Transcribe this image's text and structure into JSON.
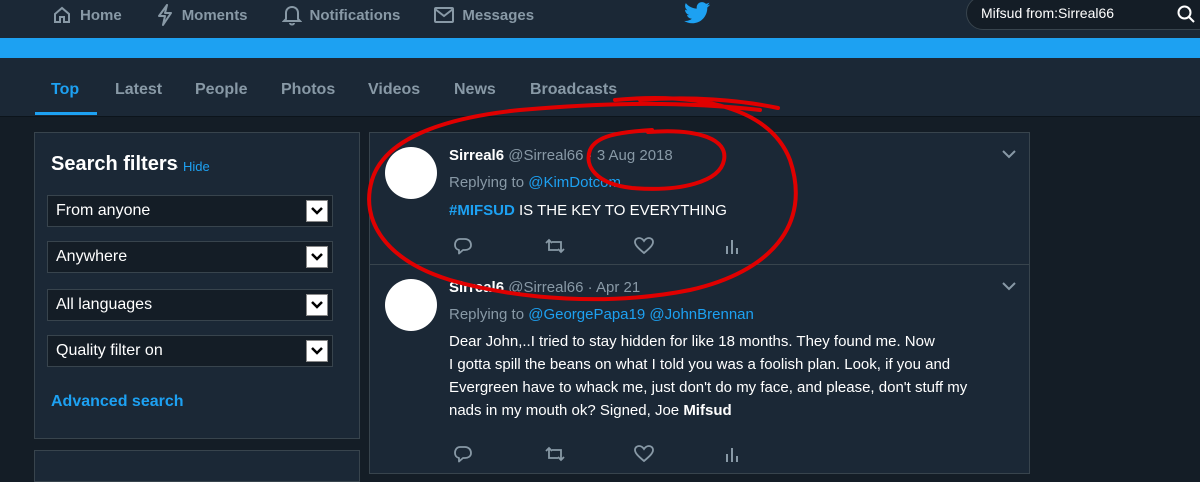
{
  "nav": {
    "home": "Home",
    "moments": "Moments",
    "notifications": "Notifications",
    "messages": "Messages"
  },
  "search": {
    "query": "Mifsud from:Sirreal66"
  },
  "tabs": [
    "Top",
    "Latest",
    "People",
    "Photos",
    "Videos",
    "News",
    "Broadcasts"
  ],
  "active_tab": "Top",
  "filters": {
    "title": "Search filters",
    "separator": "·",
    "hide": "Hide",
    "from": "From anyone",
    "location": "Anywhere",
    "language": "All languages",
    "quality": "Quality filter on",
    "advanced": "Advanced search"
  },
  "tweets": [
    {
      "name": "Sirreal6",
      "handle": "@Sirreal66",
      "sep": "·",
      "date": "3 Aug 2018",
      "replying_label": "Replying to",
      "replying_to": [
        "@KimDotcom"
      ],
      "hashtag": "#MIFSUD",
      "text": "IS THE KEY TO EVERYTHING"
    },
    {
      "name": "Sirreal6",
      "handle": "@Sirreal66",
      "sep": "·",
      "date": "Apr 21",
      "replying_label": "Replying to",
      "replying_to": [
        "@GeorgePapa19",
        "@JohnBrennan"
      ],
      "lines": [
        "Dear John,..I tried to stay hidden for like 18 months.  They found me.  Now",
        "I gotta spill the beans on what I told you was a foolish plan.  Look, if you and",
        "Evergreen have to whack me, just don't do my face, and please, don't stuff my",
        "nads in my mouth ok?  Signed, Joe "
      ],
      "signature_bold": "Mifsud"
    }
  ],
  "colors": {
    "background": "#141d26",
    "panel": "#1b2836",
    "accent": "#1da1f2",
    "muted": "#8899a6",
    "annotation": "#e00000"
  },
  "icons": [
    "home-icon",
    "lightning-icon",
    "bell-icon",
    "envelope-icon",
    "twitter-bird-icon",
    "search-icon",
    "chevron-down-icon",
    "reply-icon",
    "retweet-icon",
    "heart-icon",
    "analytics-icon"
  ]
}
